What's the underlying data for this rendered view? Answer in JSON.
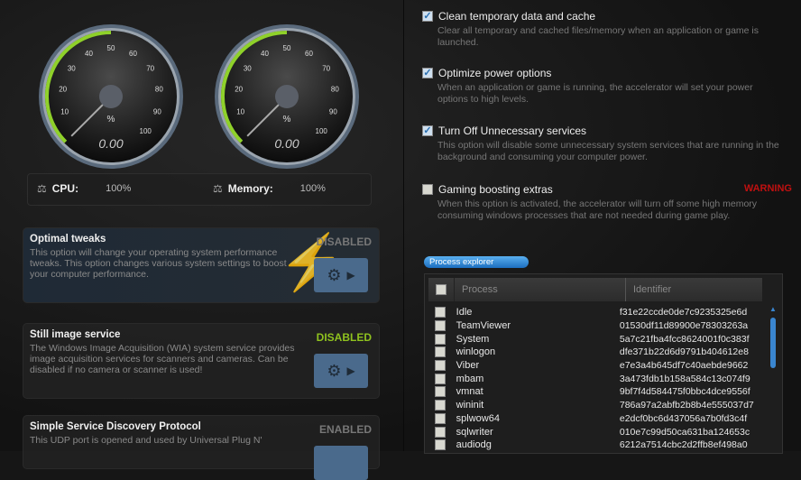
{
  "gauges": [
    {
      "name": "cpu",
      "value": 0,
      "readout": "0.00",
      "unit": "%",
      "ticks": [
        "10",
        "20",
        "30",
        "40",
        "50",
        "60",
        "70",
        "80",
        "90",
        "100"
      ]
    },
    {
      "name": "memory",
      "value": 0,
      "readout": "0.00",
      "unit": "%",
      "ticks": [
        "10",
        "20",
        "30",
        "40",
        "50",
        "60",
        "70",
        "80",
        "90",
        "100"
      ]
    }
  ],
  "stats": {
    "cpu_label": "CPU:",
    "cpu_value": "100%",
    "memory_label": "Memory:",
    "memory_value": "100%"
  },
  "cards": [
    {
      "title": "Optimal tweaks",
      "desc": "This option will change your operating system performance tweaks. This option changes various system settings to boost your computer performance.",
      "status": "DISABLED",
      "status_color": "#777777"
    },
    {
      "title": "Still image service",
      "desc": "The Windows Image Acquisition (WIA) system service provides image acquisition services for scanners and cameras. Can be disabled if no camera or scanner is used!",
      "status": "DISABLED",
      "status_color": "#8fc21e"
    },
    {
      "title": "Simple Service Discovery Protocol",
      "desc": "This UDP port is opened and used by Universal Plug N'",
      "status": "ENABLED",
      "status_color": "#777777"
    }
  ],
  "options": [
    {
      "label": "Clean temporary data and cache",
      "checked": true,
      "desc": "Clear all temporary and cached files/memory when an application or game is launched."
    },
    {
      "label": "Optimize power options",
      "checked": true,
      "desc": "When an application or game is running, the accelerator will set your power options to high levels."
    },
    {
      "label": "Turn Off Unnecessary services",
      "checked": true,
      "desc": "This option will disable some unnecessary system services that are running in the background and consuming your computer power."
    },
    {
      "label": "Gaming boosting extras",
      "checked": false,
      "desc": "When this option is activated, the accelerator will turn off some high memory consuming windows processes that are not needed during game play.",
      "warning": "WARNING"
    }
  ],
  "process_explorer": {
    "title": "Process explorer",
    "columns": [
      "Process",
      "Identifier"
    ],
    "rows": [
      [
        "Idle",
        "f31e22ccde0de7c9235325e6d"
      ],
      [
        "TeamViewer",
        "01530df11d89900e78303263a"
      ],
      [
        "System",
        "5a7c21fba4fcc8624001f0c383f"
      ],
      [
        "winlogon",
        "dfe371b22d6d9791b404612e8"
      ],
      [
        "Viber",
        "e7e3a4b645df7c40aebde9662"
      ],
      [
        "mbam",
        "3a473fdb1b158a584c13c074f9"
      ],
      [
        "vmnat",
        "9bf7f4d584475f0bbc4dce9556f"
      ],
      [
        "wininit",
        "786a97a2abfb2b8b4e555037d7"
      ],
      [
        "splwow64",
        "e2dcf0bc6d437056a7b0fd3c4f"
      ],
      [
        "sqlwriter",
        "010e7c99d50ca631ba124653c"
      ],
      [
        "audiodg",
        "6212a7514cbc2d2ffb8ef498a0"
      ]
    ]
  },
  "colors": {
    "accent_green": "#8fd12a",
    "accent_blue": "#3a86d0",
    "warning": "#c01010"
  }
}
